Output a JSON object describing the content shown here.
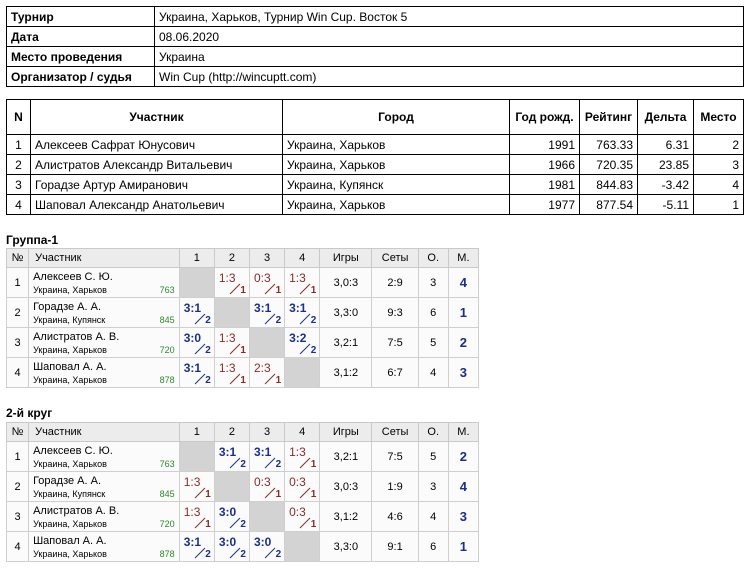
{
  "info": [
    {
      "k": "Турнир",
      "v": "Украина, Харьков, Турнир Win Cup. Восток 5"
    },
    {
      "k": "Дата",
      "v": "08.06.2020"
    },
    {
      "k": "Место проведения",
      "v": "Украина"
    },
    {
      "k": "Организатор / судья",
      "v": "Win Cup (http://wincuptt.com)"
    }
  ],
  "participants": {
    "headers": [
      "N",
      "Участник",
      "Город",
      "Год рожд.",
      "Рейтинг",
      "Дельта",
      "Место"
    ],
    "rows": [
      [
        "1",
        "Алексеев Сафрат Юнусович",
        "Украина, Харьков",
        "1991",
        "763.33",
        "6.31",
        "2"
      ],
      [
        "2",
        "Алистратов Александр Витальевич",
        "Украина, Харьков",
        "1966",
        "720.35",
        "23.85",
        "3"
      ],
      [
        "3",
        "Горадзе Артур Амиранович",
        "Украина, Купянск",
        "1981",
        "844.83",
        "-3.42",
        "4"
      ],
      [
        "4",
        "Шаповал Александр Анатольевич",
        "Украина, Харьков",
        "1977",
        "877.54",
        "-5.11",
        "1"
      ]
    ]
  },
  "group_headers": [
    "№",
    "Участник",
    "1",
    "2",
    "3",
    "4",
    "Игры",
    "Сеты",
    "О.",
    "М."
  ],
  "groups": [
    {
      "title": "Группа-1",
      "rows": [
        {
          "n": "1",
          "name": "Алексеев С. Ю.",
          "city": "Украина, Харьков",
          "rating": "763",
          "cells": [
            null,
            {
              "s": "1:3",
              "p": "1",
              "w": false
            },
            {
              "s": "0:3",
              "p": "1",
              "w": false
            },
            {
              "s": "1:3",
              "p": "1",
              "w": false
            }
          ],
          "games": "3,0:3",
          "sets": "2:9",
          "pts": "3",
          "place": "4"
        },
        {
          "n": "2",
          "name": "Горадзе А. А.",
          "city": "Украина, Купянск",
          "rating": "845",
          "cells": [
            {
              "s": "3:1",
              "p": "2",
              "w": true
            },
            null,
            {
              "s": "3:1",
              "p": "2",
              "w": true
            },
            {
              "s": "3:1",
              "p": "2",
              "w": true
            }
          ],
          "games": "3,3:0",
          "sets": "9:3",
          "pts": "6",
          "place": "1"
        },
        {
          "n": "3",
          "name": "Алистратов А. В.",
          "city": "Украина, Харьков",
          "rating": "720",
          "cells": [
            {
              "s": "3:0",
              "p": "2",
              "w": true
            },
            {
              "s": "1:3",
              "p": "1",
              "w": false
            },
            null,
            {
              "s": "3:2",
              "p": "2",
              "w": true
            }
          ],
          "games": "3,2:1",
          "sets": "7:5",
          "pts": "5",
          "place": "2"
        },
        {
          "n": "4",
          "name": "Шаповал А. А.",
          "city": "Украина, Харьков",
          "rating": "878",
          "cells": [
            {
              "s": "3:1",
              "p": "2",
              "w": true
            },
            {
              "s": "1:3",
              "p": "1",
              "w": false
            },
            {
              "s": "2:3",
              "p": "1",
              "w": false
            },
            null
          ],
          "games": "3,1:2",
          "sets": "6:7",
          "pts": "4",
          "place": "3"
        }
      ]
    },
    {
      "title": "2-й круг",
      "rows": [
        {
          "n": "1",
          "name": "Алексеев С. Ю.",
          "city": "Украина, Харьков",
          "rating": "763",
          "cells": [
            null,
            {
              "s": "3:1",
              "p": "2",
              "w": true
            },
            {
              "s": "3:1",
              "p": "2",
              "w": true
            },
            {
              "s": "1:3",
              "p": "1",
              "w": false
            }
          ],
          "games": "3,2:1",
          "sets": "7:5",
          "pts": "5",
          "place": "2"
        },
        {
          "n": "2",
          "name": "Горадзе А. А.",
          "city": "Украина, Купянск",
          "rating": "845",
          "cells": [
            {
              "s": "1:3",
              "p": "1",
              "w": false
            },
            null,
            {
              "s": "0:3",
              "p": "1",
              "w": false
            },
            {
              "s": "0:3",
              "p": "1",
              "w": false
            }
          ],
          "games": "3,0:3",
          "sets": "1:9",
          "pts": "3",
          "place": "4"
        },
        {
          "n": "3",
          "name": "Алистратов А. В.",
          "city": "Украина, Харьков",
          "rating": "720",
          "cells": [
            {
              "s": "1:3",
              "p": "1",
              "w": false
            },
            {
              "s": "3:0",
              "p": "2",
              "w": true
            },
            null,
            {
              "s": "0:3",
              "p": "1",
              "w": false
            }
          ],
          "games": "3,1:2",
          "sets": "4:6",
          "pts": "4",
          "place": "3"
        },
        {
          "n": "4",
          "name": "Шаповал А. А.",
          "city": "Украина, Харьков",
          "rating": "878",
          "cells": [
            {
              "s": "3:1",
              "p": "2",
              "w": true
            },
            {
              "s": "3:0",
              "p": "2",
              "w": true
            },
            {
              "s": "3:0",
              "p": "2",
              "w": true
            },
            null
          ],
          "games": "3,3:0",
          "sets": "9:1",
          "pts": "6",
          "place": "1"
        }
      ]
    }
  ]
}
